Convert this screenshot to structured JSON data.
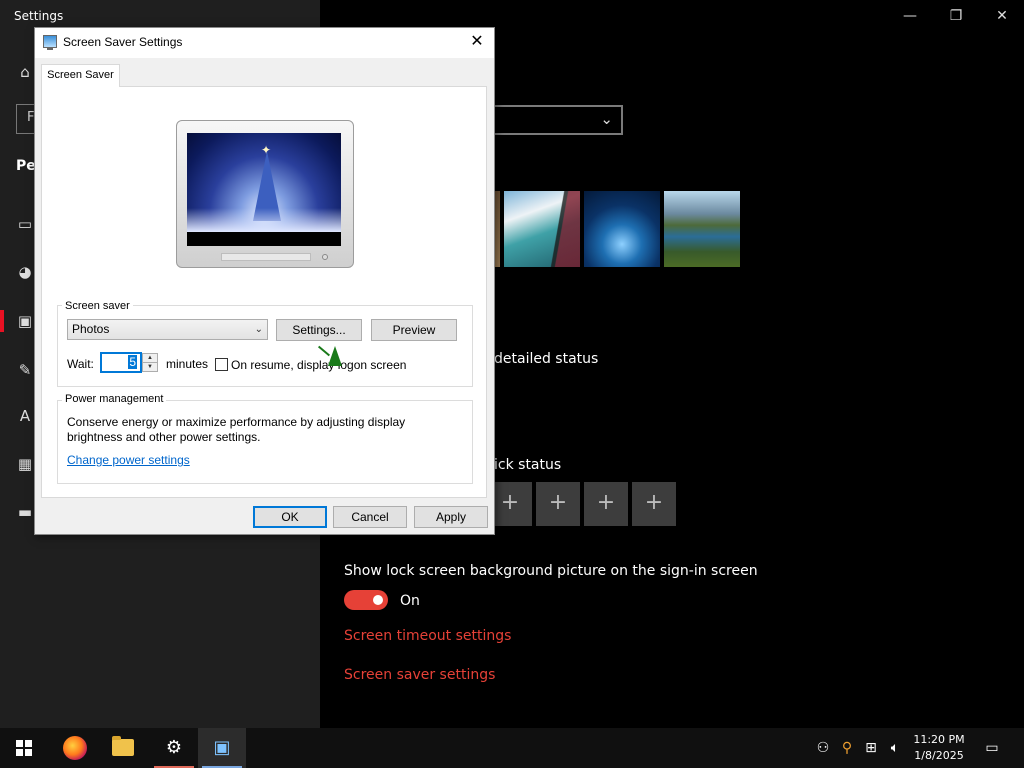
{
  "settings": {
    "window_title": "Settings",
    "search_partial": "F",
    "section_partial": "Per",
    "detailed_status_partial": "detailed status",
    "quick_status_partial": "ick status",
    "lock_bg_label": "Show lock screen background picture on the sign-in screen",
    "toggle_state": "On",
    "screen_timeout_link": "Screen timeout settings",
    "screen_saver_link": "Screen saver settings"
  },
  "dialog": {
    "title": "Screen Saver Settings",
    "tab_label": "Screen Saver",
    "screen_saver_group_label": "Screen saver",
    "selected_screen_saver": "Photos",
    "settings_button": "Settings...",
    "preview_button": "Preview",
    "wait_label": "Wait:",
    "wait_value": "5",
    "minutes_label": "minutes",
    "resume_checkbox_label": "On resume, display logon screen",
    "resume_checked": false,
    "power_group_label": "Power management",
    "power_description": "Conserve energy or maximize performance by adjusting display brightness and other power settings.",
    "power_link": "Change power settings",
    "ok_button": "OK",
    "cancel_button": "Cancel",
    "apply_button": "Apply"
  },
  "taskbar": {
    "time": "11:20 PM",
    "date": "1/8/2025"
  },
  "colors": {
    "accent_red": "#e64137",
    "focus_blue": "#0078d7",
    "link_blue": "#0066cc"
  }
}
